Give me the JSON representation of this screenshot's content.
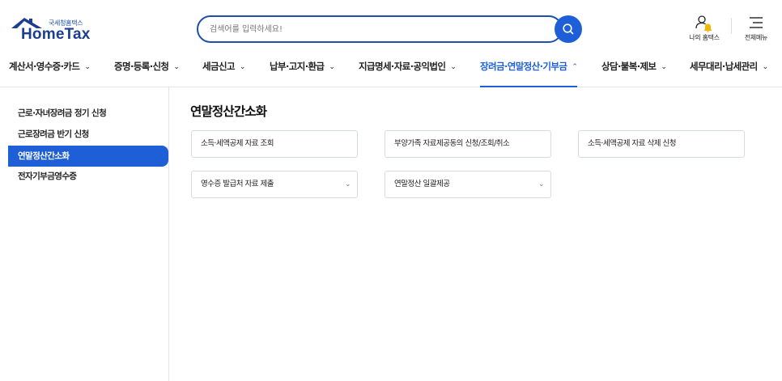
{
  "header": {
    "logo_sub": "국세청홈택스",
    "logo_main": "HomeTax",
    "search_placeholder": "검색어를 입력하세요!",
    "my_hometax": "나의 홈택스",
    "all_menu": "전체메뉴"
  },
  "nav": {
    "items": [
      {
        "label": "계산서·영수증·카드"
      },
      {
        "label": "증명·등록·신청"
      },
      {
        "label": "세금신고"
      },
      {
        "label": "납부·고지·환급"
      },
      {
        "label": "지급명세·자료·공익법인"
      },
      {
        "label": "장려금·연말정산·기부금"
      },
      {
        "label": "상담·불복·제보"
      },
      {
        "label": "세무대리·납세관리"
      }
    ],
    "active_index": 5
  },
  "sidebar": {
    "items": [
      {
        "label": "근로·자녀장려금 정기 신청"
      },
      {
        "label": "근로장려금 반기 신청"
      },
      {
        "label": "연말정산간소화"
      },
      {
        "label": "전자기부금영수증"
      }
    ],
    "active_index": 2
  },
  "main": {
    "title": "연말정산간소화",
    "cards": [
      {
        "label": "소득·세액공제 자료 조회",
        "dropdown": false
      },
      {
        "label": "부양가족 자료제공동의 신청/조회/취소",
        "dropdown": false
      },
      {
        "label": "소득·세액공제 자료 삭제 신청",
        "dropdown": false
      },
      {
        "label": "영수증 발급처 자료 제출",
        "dropdown": true
      },
      {
        "label": "연말정산 일괄제공",
        "dropdown": true
      }
    ]
  },
  "colors": {
    "accent": "#1e5fd8",
    "brand_dark": "#1b3e8f",
    "bell": "#f2b705"
  },
  "icons": {
    "search": "search-icon",
    "user_bell": "user-bell-icon",
    "menu": "hamburger-icon",
    "chevron_down": "chevron-down-icon",
    "chevron_up": "chevron-up-icon"
  }
}
